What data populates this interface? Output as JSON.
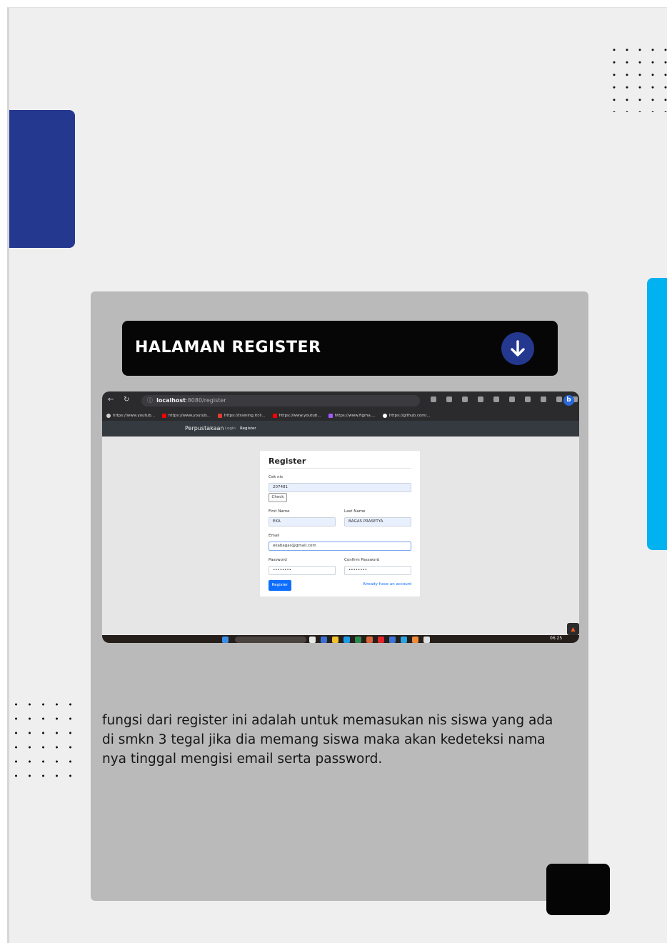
{
  "card": {
    "title": "HALAMAN REGISTER",
    "description": "fungsi dari register ini adalah untuk memasukan nis siswa yang ada di smkn 3 tegal jika dia memang siswa maka akan kedeteksi nama nya tinggal mengisi email serta password."
  },
  "screenshot": {
    "browser": {
      "url_host": "localhost",
      "url_path": ":8080/register",
      "bookmarks": [
        {
          "label": "https://www.youtub...",
          "color": "#cfcfcf"
        },
        {
          "label": "https://www.youtub...",
          "color": "#ff0000"
        },
        {
          "label": "https://training.itcli...",
          "color": "#e03c31"
        },
        {
          "label": "https://www.youtub...",
          "color": "#ff0000"
        },
        {
          "label": "https://www.figma....",
          "color": "#a259ff"
        },
        {
          "label": "https://github.com/...",
          "color": "#ffffff"
        }
      ]
    },
    "app_nav": {
      "brand": "Perpustakaan",
      "links": [
        "Login",
        "Register"
      ]
    },
    "form": {
      "title": "Register",
      "nis_label": "Cek nis",
      "nis_value": "207481",
      "check_button": "Check",
      "first_name_label": "First Name",
      "first_name_value": "EKA",
      "last_name_label": "Last Name",
      "last_name_value": "BAGAS PRASETYA",
      "email_label": "Email",
      "email_value": "ekabagas@gmail.com",
      "password_label": "Password",
      "password_value": "••••••••",
      "confirm_label": "Confirm Password",
      "confirm_value": "••••••••",
      "register_button": "Register",
      "login_link": "Already have an account"
    },
    "taskbar": {
      "time": "06.25"
    }
  },
  "colors": {
    "navy": "#25388f",
    "cyan": "#00b2ef",
    "card_gray": "#bbbaba",
    "title_bar": "#060606"
  }
}
